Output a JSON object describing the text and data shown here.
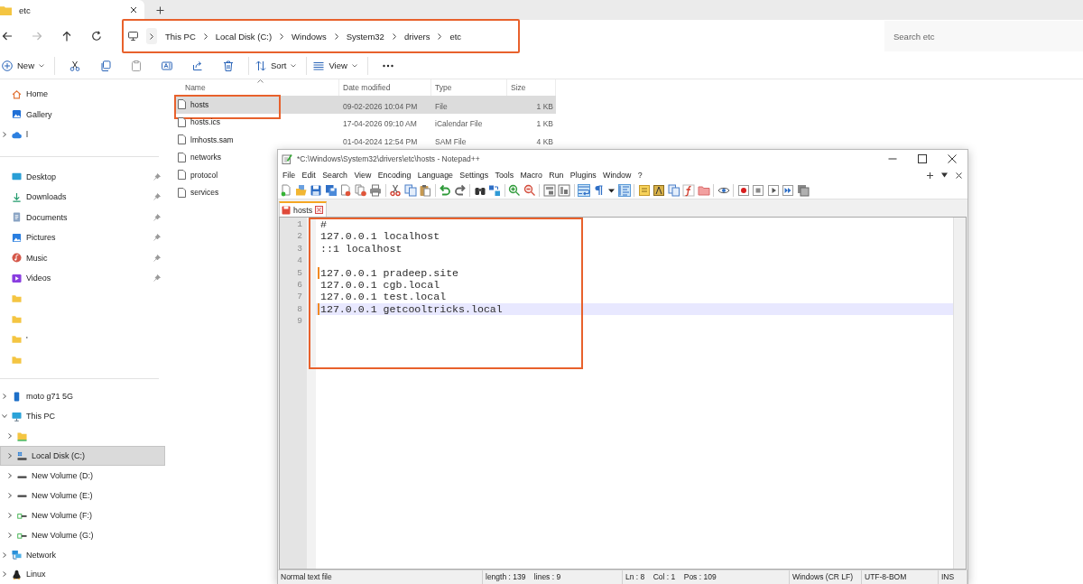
{
  "explorer": {
    "tabs": [
      {
        "label": "etc",
        "selected": true
      }
    ],
    "nav_buttons": [
      {
        "kind": "back",
        "disabled": false
      },
      {
        "kind": "forward",
        "disabled": true
      },
      {
        "kind": "up",
        "disabled": false
      },
      {
        "kind": "refresh",
        "disabled": false
      }
    ],
    "address": {
      "highlighted": true,
      "breadcrumbs": [
        "This PC",
        "Local Disk (C:)",
        "Windows",
        "System32",
        "drivers",
        "etc"
      ]
    },
    "search": {
      "placeholder": "Search etc"
    },
    "commands": [
      {
        "kind": "new",
        "label": "New",
        "disabled": false
      },
      {
        "kind": "cut",
        "disabled": false
      },
      {
        "kind": "copy",
        "disabled": false
      },
      {
        "kind": "paste",
        "disabled": true
      },
      {
        "kind": "rename",
        "disabled": false
      },
      {
        "kind": "share",
        "disabled": false
      },
      {
        "kind": "delete",
        "disabled": false
      },
      {
        "kind": "sort",
        "label": "Sort",
        "disabled": false
      },
      {
        "kind": "view",
        "label": "View",
        "disabled": false
      },
      {
        "kind": "more",
        "disabled": false
      }
    ],
    "sidebar": [
      {
        "items": [
          {
            "label": "Home",
            "kind": "home",
            "pinned": false,
            "selected": false
          },
          {
            "label": "Gallery",
            "kind": "gallery",
            "pinned": false,
            "selected": false
          },
          {
            "label": "l",
            "kind": "cloud",
            "pinned": false,
            "selected": false,
            "expanded": false
          }
        ]
      },
      {
        "items": [
          {
            "label": "Desktop",
            "kind": "desktop",
            "pinned": true,
            "selected": false
          },
          {
            "label": "Downloads",
            "kind": "downloads",
            "pinned": true,
            "selected": false
          },
          {
            "label": "Documents",
            "kind": "documents",
            "pinned": true,
            "selected": false
          },
          {
            "label": "Pictures",
            "kind": "pictures",
            "pinned": true,
            "selected": false
          },
          {
            "label": "Music",
            "kind": "music",
            "pinned": true,
            "selected": false
          },
          {
            "label": "Videos",
            "kind": "videos",
            "pinned": true,
            "selected": false
          },
          {
            "kind": "folder",
            "pinned": false,
            "selected": false
          },
          {
            "kind": "folder",
            "pinned": false,
            "selected": false
          },
          {
            "label": "'",
            "kind": "folder",
            "pinned": false,
            "selected": false
          },
          {
            "kind": "folder",
            "pinned": false,
            "selected": false
          }
        ]
      },
      {
        "items": [
          {
            "label": "moto g71 5G",
            "kind": "phone",
            "pinned": false,
            "selected": false,
            "expanded": false
          },
          {
            "label": "This PC",
            "kind": "pc",
            "pinned": false,
            "selected": false,
            "expanded": true,
            "children": [
              {
                "kind": "drive-folder",
                "pinned": false,
                "selected": false,
                "expanded": false
              },
              {
                "label": "Local Disk (C:)",
                "kind": "system-disk",
                "pinned": false,
                "selected": true,
                "expanded": false
              },
              {
                "label": "New Volume (D:)",
                "kind": "disk",
                "pinned": false,
                "selected": false,
                "expanded": false
              },
              {
                "label": "New Volume (E:)",
                "kind": "disk",
                "pinned": false,
                "selected": false,
                "expanded": false
              },
              {
                "label": "New Volume (F:)",
                "kind": "usb-disk",
                "pinned": false,
                "selected": false,
                "expanded": false
              },
              {
                "label": "New Volume (G:)",
                "kind": "usb-disk",
                "pinned": false,
                "selected": false,
                "expanded": false
              }
            ]
          },
          {
            "label": "Network",
            "kind": "network",
            "pinned": false,
            "selected": false,
            "expanded": false
          },
          {
            "label": "Linux",
            "kind": "linux",
            "pinned": false,
            "selected": false,
            "expanded": false
          }
        ]
      }
    ],
    "files": {
      "columns": [
        "Name",
        "Date modified",
        "Type",
        "Size"
      ],
      "rows": [
        {
          "name": "hosts",
          "modified": "09-02-2026 10:04 PM",
          "type": "File",
          "size": "1 KB",
          "selected": true,
          "highlighted": true
        },
        {
          "name": "hosts.ics",
          "modified": "17-04-2026 09:10 AM",
          "type": "iCalendar File",
          "size": "1 KB",
          "selected": false,
          "highlighted": false
        },
        {
          "name": "lmhosts.sam",
          "modified": "01-04-2024 12:54 PM",
          "type": "SAM File",
          "size": "4 KB",
          "selected": false,
          "highlighted": false
        },
        {
          "name": "networks",
          "selected": false,
          "highlighted": false
        },
        {
          "name": "protocol",
          "selected": false,
          "highlighted": false
        },
        {
          "name": "services",
          "selected": false,
          "highlighted": false
        }
      ]
    }
  },
  "notepad": {
    "title": "*C:\\Windows\\System32\\drivers\\etc\\hosts - Notepad++",
    "menu": [
      "File",
      "Edit",
      "Search",
      "View",
      "Encoding",
      "Language",
      "Settings",
      "Tools",
      "Macro",
      "Run",
      "Plugins",
      "Window",
      "?"
    ],
    "toolbar": [
      {
        "tools": [
          {
            "kind": "new",
            "pressed": false
          },
          {
            "kind": "open",
            "pressed": false
          },
          {
            "kind": "save",
            "pressed": false
          },
          {
            "kind": "save-all",
            "pressed": false
          },
          {
            "kind": "close",
            "pressed": false
          },
          {
            "kind": "close-all",
            "pressed": false
          },
          {
            "kind": "print",
            "pressed": false
          }
        ]
      },
      {
        "tools": [
          {
            "kind": "cut",
            "pressed": false
          },
          {
            "kind": "copy",
            "pressed": false
          },
          {
            "kind": "paste",
            "pressed": false
          }
        ]
      },
      {
        "tools": [
          {
            "kind": "undo",
            "pressed": false
          },
          {
            "kind": "redo",
            "pressed": false
          }
        ]
      },
      {
        "tools": [
          {
            "kind": "find",
            "pressed": false
          },
          {
            "kind": "replace",
            "pressed": false
          }
        ]
      },
      {
        "tools": [
          {
            "kind": "zoom-in",
            "pressed": false
          },
          {
            "kind": "zoom-out",
            "pressed": false
          }
        ]
      },
      {
        "tools": [
          {
            "kind": "sync-vertical",
            "pressed": false
          },
          {
            "kind": "sync-horizontal",
            "pressed": false
          }
        ]
      },
      {
        "tools": [
          {
            "kind": "word-wrap",
            "pressed": true
          },
          {
            "kind": "all-chars",
            "pressed": false
          },
          {
            "kind": "dropdown",
            "pressed": false
          },
          {
            "kind": "indent-guide",
            "pressed": true
          }
        ]
      },
      {
        "tools": [
          {
            "kind": "user-language",
            "pressed": false
          },
          {
            "kind": "doc-map",
            "pressed": false
          },
          {
            "kind": "doc-list",
            "pressed": false
          },
          {
            "kind": "function-list",
            "pressed": false
          },
          {
            "kind": "folder-workspace",
            "pressed": false
          }
        ]
      },
      {
        "tools": [
          {
            "kind": "monitoring",
            "pressed": false
          }
        ]
      },
      {
        "tools": [
          {
            "kind": "record",
            "pressed": false
          },
          {
            "kind": "stop",
            "pressed": false
          },
          {
            "kind": "play",
            "pressed": false
          },
          {
            "kind": "play-multiple",
            "pressed": false
          },
          {
            "kind": "save-macro",
            "pressed": false
          }
        ]
      }
    ],
    "tabs": [
      {
        "label": "hosts",
        "selected": true,
        "modified": true
      }
    ],
    "editor": {
      "highlighted": true,
      "lines": [
        {
          "number": "1",
          "text": "#",
          "changed": false,
          "current": false
        },
        {
          "number": "2",
          "text": "127.0.0.1 localhost",
          "changed": false,
          "current": false
        },
        {
          "number": "3",
          "text": "::1 localhost",
          "changed": false,
          "current": false
        },
        {
          "number": "4",
          "changed": false,
          "current": false
        },
        {
          "number": "5",
          "text": "127.0.0.1 pradeep.site",
          "changed": true,
          "current": false
        },
        {
          "number": "6",
          "text": "127.0.0.1 cgb.local",
          "changed": false,
          "current": false
        },
        {
          "number": "7",
          "text": "127.0.0.1 test.local",
          "changed": false,
          "current": false
        },
        {
          "number": "8",
          "text": "127.0.0.1 getcooltricks.local",
          "changed": true,
          "current": true
        },
        {
          "number": "9",
          "changed": false,
          "current": false
        }
      ]
    },
    "status_bar": [
      "Normal text file",
      "length : 139    lines : 9",
      "Ln : 8    Col : 1    Pos : 109",
      "Windows (CR LF)",
      "UTF-8-BOM",
      "INS"
    ]
  }
}
